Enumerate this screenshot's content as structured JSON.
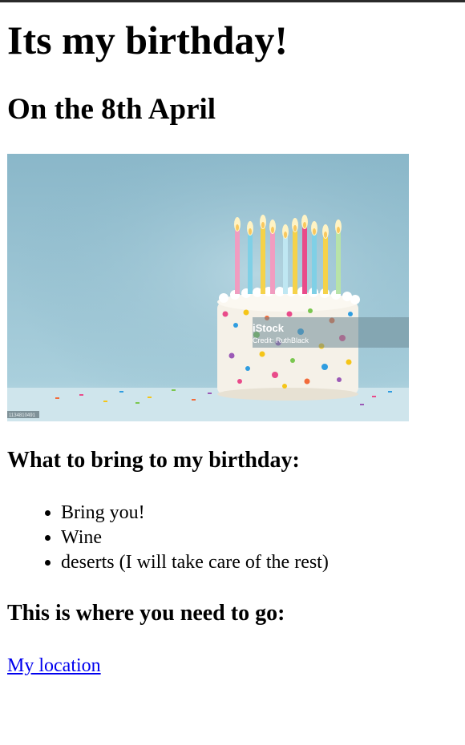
{
  "page": {
    "title": "Its my birthday!",
    "subtitle": "On the 8th April"
  },
  "hero_image": {
    "alt": "Birthday cake with candles and sprinkles",
    "watermark_brand": "iStock",
    "watermark_credit": "Credit: RuthBlack",
    "stock_id": "1134810491"
  },
  "bring": {
    "heading": "What to bring to my birthday:",
    "items": [
      {
        "label": "Bring you!"
      },
      {
        "label": "Wine"
      },
      {
        "label": "deserts (I will take care of the rest)"
      }
    ]
  },
  "location": {
    "heading": "This is where you need to go:",
    "link_label": "My location"
  },
  "colors": {
    "link": "#0000ee",
    "image_bg": "#8fbccc"
  }
}
